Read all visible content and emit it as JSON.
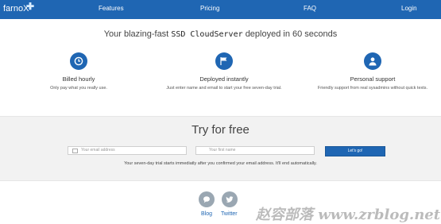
{
  "header": {
    "logo": "farnoX",
    "nav": [
      "Features",
      "Pricing",
      "FAQ",
      "Login"
    ]
  },
  "hero": {
    "prefix": "Your blazing-fast",
    "product": "SSD CloudServer",
    "suffix": "deployed in 60 seconds"
  },
  "features": [
    {
      "icon": "clock-icon",
      "title": "Billed hourly",
      "desc": "Only pay what you really use."
    },
    {
      "icon": "flag-icon",
      "title": "Deployed instantly",
      "desc": "Just enter name and email to start your free seven-day trial."
    },
    {
      "icon": "user-icon",
      "title": "Personal support",
      "desc": "Friendly support from real sysadmins without quick texts."
    }
  ],
  "trial": {
    "heading": "Try for free",
    "email_placeholder": "Your email address",
    "name_placeholder": "Your first name",
    "button": "Let's go!",
    "note": "Your seven-day trial starts immediatly after you confirmed your email address. It'll end automatically."
  },
  "footer": {
    "links": [
      "Blog",
      "Twitter"
    ]
  },
  "watermark": "赵容部落 www.zrblog.net",
  "colors": {
    "primary": "#1f66b3",
    "trial_bg": "#f2f2f2",
    "social_icon": "#9aa7b2"
  }
}
